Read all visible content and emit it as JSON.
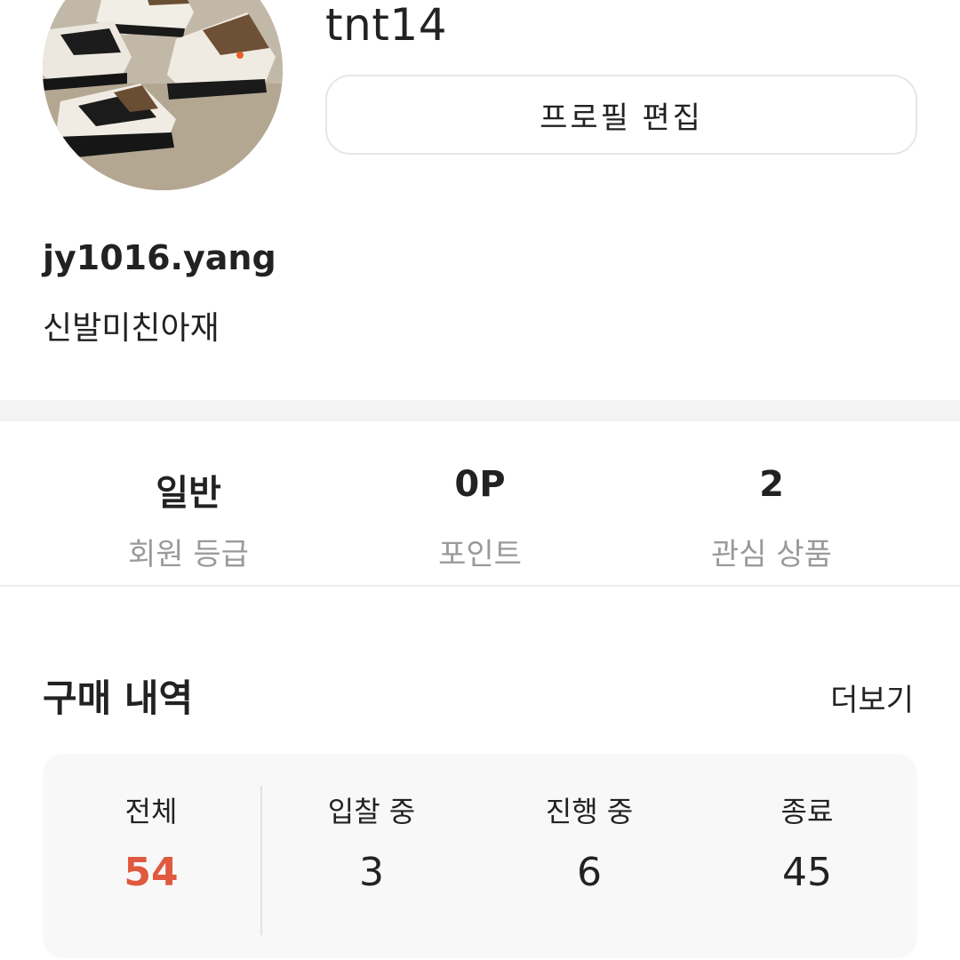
{
  "profile": {
    "nickname": "tnt14",
    "edit_button_label": "프로필 편집",
    "user_id": "jy1016.yang",
    "bio": "신발미친아재"
  },
  "stats": [
    {
      "value": "일반",
      "label": "회원 등급"
    },
    {
      "value": "0P",
      "label": "포인트"
    },
    {
      "value": "2",
      "label": "관심 상품"
    }
  ],
  "purchase_history": {
    "title": "구매 내역",
    "more_label": "더보기",
    "summary": [
      {
        "label": "전체",
        "value": "54"
      },
      {
        "label": "입찰 중",
        "value": "3"
      },
      {
        "label": "진행 중",
        "value": "6"
      },
      {
        "label": "종료",
        "value": "45"
      }
    ]
  },
  "colors": {
    "accent": "#e0593f",
    "muted_text": "#9a9a9a",
    "panel_bg": "#f8f8f8"
  }
}
